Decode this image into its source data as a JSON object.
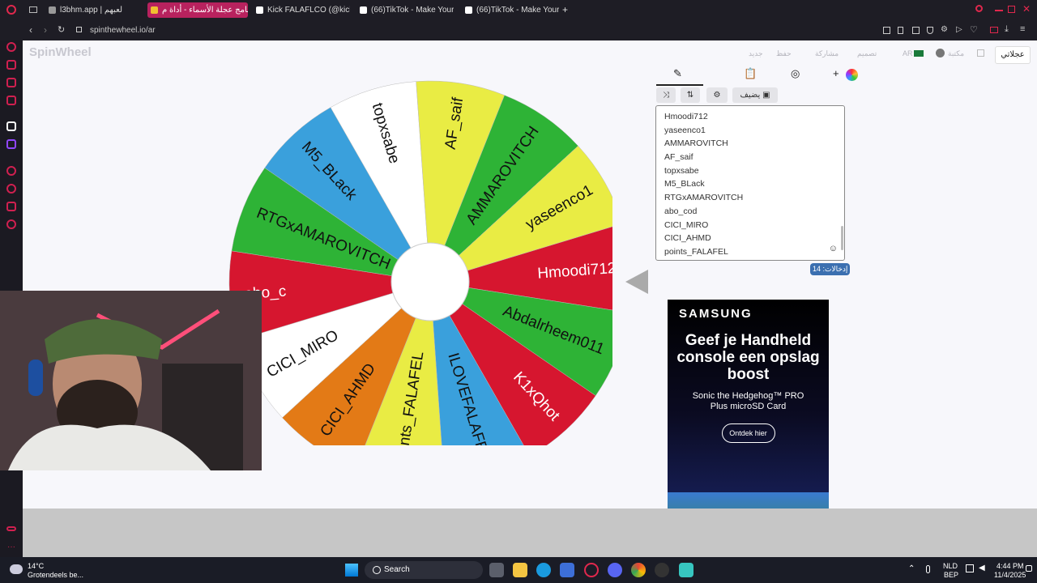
{
  "browser": {
    "tabs": [
      {
        "label": "l3bhm.app | لعبهم"
      },
      {
        "label": "برنامج عجلة الأسماء - أداة م..."
      },
      {
        "label": "Kick FALAFLCO (@kick_S"
      },
      {
        "label": "(66)TikTok - Make Your D"
      },
      {
        "label": "(66)TikTok - Make Your D"
      }
    ],
    "new_tab": "+",
    "url": "spinthewheel.io/ar"
  },
  "site": {
    "logo": "SpinWheel",
    "toolbar": {
      "new_label": "جديد",
      "save_label": "حفظ",
      "share_label": "مشاركة",
      "design_label": "تصميم",
      "lang_code": "AR",
      "account_label": "مكتبة",
      "wheel_label": "عجلاتي"
    },
    "editor": {
      "add_label": "+",
      "add_image_label": "يضيف",
      "entries": [
        "Hmoodi712",
        "yaseenco1",
        "AMMAROVITCH",
        "AF_saif",
        "topxsabe",
        "M5_BLack",
        "RTGxAMAROVITCH",
        "abo_cod",
        "CICI_MIRO",
        "CICI_AHMD",
        "points_FALAFEL"
      ],
      "entries_count": "إدخالات: 14"
    },
    "wheel": {
      "segments": [
        {
          "label": "Hmoodi712",
          "color": "#d6162f"
        },
        {
          "label": "Abdalrheem011",
          "color": "#2eb336"
        },
        {
          "label": "K1xQhot",
          "color": "#d6162f"
        },
        {
          "label": "ILOVEFALAFEL",
          "color": "#3aa0dc"
        },
        {
          "label": "points_FALAFEL",
          "color": "#e9ec44"
        },
        {
          "label": "CICI_AHMD",
          "color": "#e37a16"
        },
        {
          "label": "CICI_MIRO",
          "color": "#ffffff"
        },
        {
          "label": "abo_c",
          "color": "#d6162f"
        },
        {
          "label": "RTGxAMAROVITCH",
          "color": "#2eb336"
        },
        {
          "label": "M5_BLack",
          "color": "#3aa0dc"
        },
        {
          "label": "topxsabe",
          "color": "#ffffff"
        },
        {
          "label": "AF_saif",
          "color": "#e9ec44"
        },
        {
          "label": "AMMAROVITCH",
          "color": "#2eb336"
        },
        {
          "label": "yaseenco1",
          "color": "#e9ec44"
        }
      ]
    },
    "ad": {
      "brand": "SAMSUNG",
      "headline": "Geef je Handheld console een opslag boost",
      "sub": "Sonic the Hedgehog™ PRO Plus microSD Card",
      "cta": "Ontdek hier",
      "close": "✕"
    }
  },
  "taskbar": {
    "weather_temp": "14°C",
    "weather_desc": "Grotendeels be...",
    "search_placeholder": "Search",
    "lang_top": "NLD",
    "lang_bottom": "BEP",
    "time": "4:44 PM",
    "date": "11/4/2025"
  }
}
